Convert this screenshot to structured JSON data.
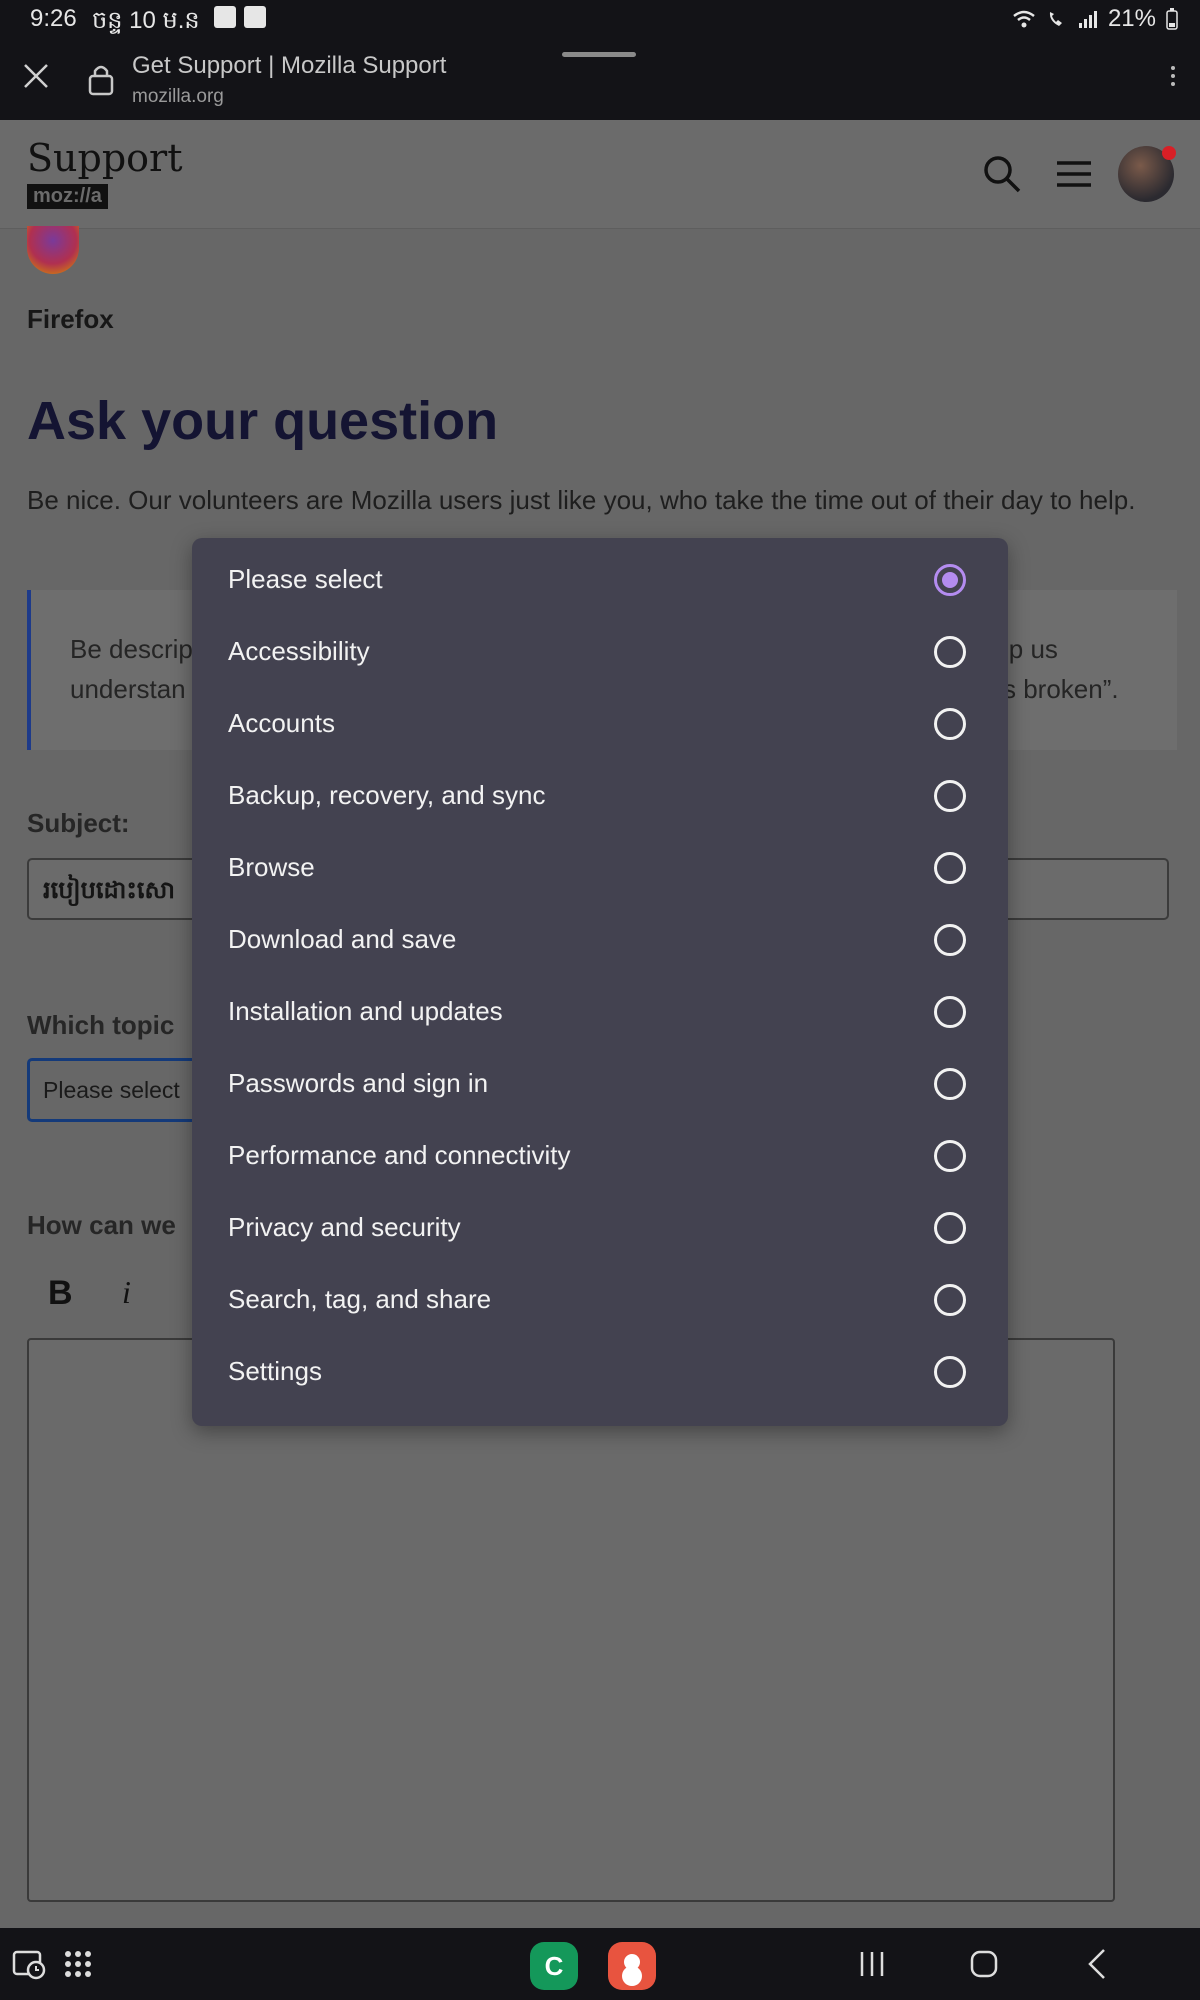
{
  "status_bar": {
    "time": "9:26",
    "date": "ចន្ទ 10 ម.ន",
    "battery": "21%"
  },
  "browser": {
    "page_title": "Get Support | Mozilla Support",
    "url": "mozilla.org"
  },
  "site_header": {
    "logo_word": "Support",
    "logo_brand": "moz://a"
  },
  "page": {
    "product": "Firefox",
    "heading": "Ask your question",
    "intro": "Be nice. Our volunteers are Mozilla users just like you, who take the time out of their day to help.",
    "tip_left_line1": "Be descrip",
    "tip_left_line2": "understan",
    "tip_right_line1": "lp us",
    "tip_right_line2": "s broken”.",
    "subject_label": "Subject:",
    "subject_value": "របៀបដោះសោ",
    "topic_label": "Which topic",
    "topic_value": "Please select",
    "help_label": "How can we",
    "bold_button": "B",
    "italic_button": "i"
  },
  "topic_dialog": {
    "options": [
      {
        "label": "Please select",
        "selected": true
      },
      {
        "label": "Accessibility",
        "selected": false
      },
      {
        "label": "Accounts",
        "selected": false
      },
      {
        "label": "Backup, recovery, and sync",
        "selected": false
      },
      {
        "label": "Browse",
        "selected": false
      },
      {
        "label": "Download and save",
        "selected": false
      },
      {
        "label": "Installation and updates",
        "selected": false
      },
      {
        "label": "Passwords and sign in",
        "selected": false
      },
      {
        "label": "Performance and connectivity",
        "selected": false
      },
      {
        "label": "Privacy and security",
        "selected": false
      },
      {
        "label": "Search, tag, and share",
        "selected": false
      },
      {
        "label": "Settings",
        "selected": false
      }
    ],
    "accent_color": "#b48cf0"
  }
}
